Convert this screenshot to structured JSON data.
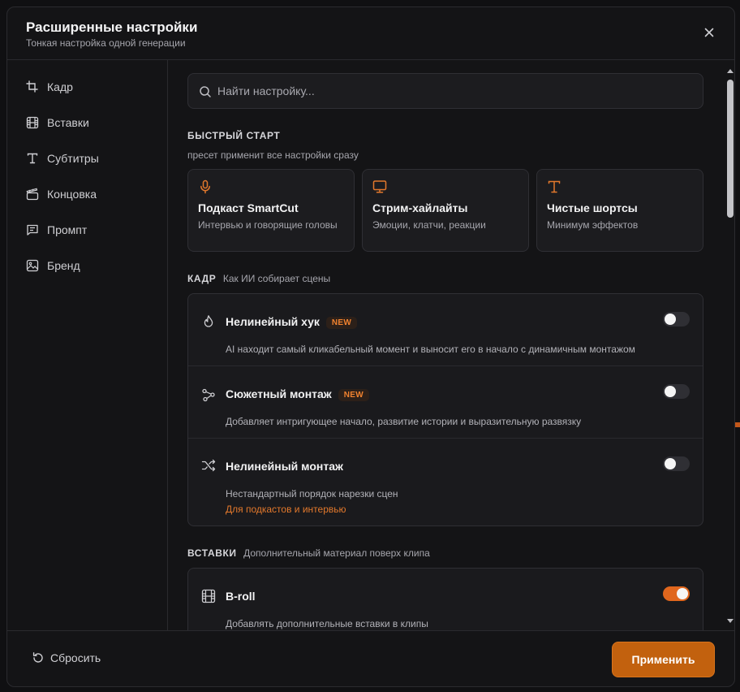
{
  "header": {
    "title": "Расширенные настройки",
    "subtitle": "Тонкая настройка одной генерации"
  },
  "sidebar": {
    "items": [
      {
        "label": "Кадр",
        "icon": "crop-icon"
      },
      {
        "label": "Вставки",
        "icon": "film-icon"
      },
      {
        "label": "Субтитры",
        "icon": "text-icon"
      },
      {
        "label": "Концовка",
        "icon": "clapperboard-icon"
      },
      {
        "label": "Промпт",
        "icon": "message-icon"
      },
      {
        "label": "Бренд",
        "icon": "image-icon"
      }
    ]
  },
  "search": {
    "placeholder": "Найти настройку..."
  },
  "quick_start": {
    "heading": "БЫСТРЫЙ СТАРТ",
    "description": "пресет применит все настройки сразу",
    "presets": [
      {
        "title": "Подкаст SmartCut",
        "desc": "Интервью и говорящие головы",
        "icon": "microphone-icon"
      },
      {
        "title": "Стрим-хайлайты",
        "desc": "Эмоции, клатчи, реакции",
        "icon": "monitor-icon"
      },
      {
        "title": "Чистые шортсы",
        "desc": "Минимум эффектов",
        "icon": "text-icon"
      }
    ]
  },
  "frame": {
    "heading": "КАДР",
    "description": "Как ИИ собирает сцены",
    "rows": [
      {
        "title": "Нелинейный хук",
        "badge": "NEW",
        "desc": "AI находит самый кликабельный момент и выносит его в начало с динамичным монтажом",
        "enabled": false,
        "icon": "flame-icon"
      },
      {
        "title": "Сюжетный монтаж",
        "badge": "NEW",
        "desc": "Добавляет интригующее начало, развитие истории и выразительную развязку",
        "enabled": false,
        "icon": "route-icon"
      },
      {
        "title": "Нелинейный монтаж",
        "desc": "Нестандартный порядок нарезки сцен",
        "link": "Для подкастов и интервью",
        "enabled": false,
        "icon": "shuffle-icon"
      }
    ]
  },
  "inserts": {
    "heading": "ВСТАВКИ",
    "description": "Дополнительный материал поверх клипа",
    "rows": [
      {
        "title": "B-roll",
        "desc": "Добавлять дополнительные вставки в клипы",
        "enabled": true,
        "icon": "film-icon"
      }
    ]
  },
  "footer": {
    "reset_label": "Сбросить",
    "apply_label": "Применить"
  },
  "colors": {
    "accent": "#e0661d",
    "apply_button": "#c2610e",
    "background": "#141416"
  }
}
